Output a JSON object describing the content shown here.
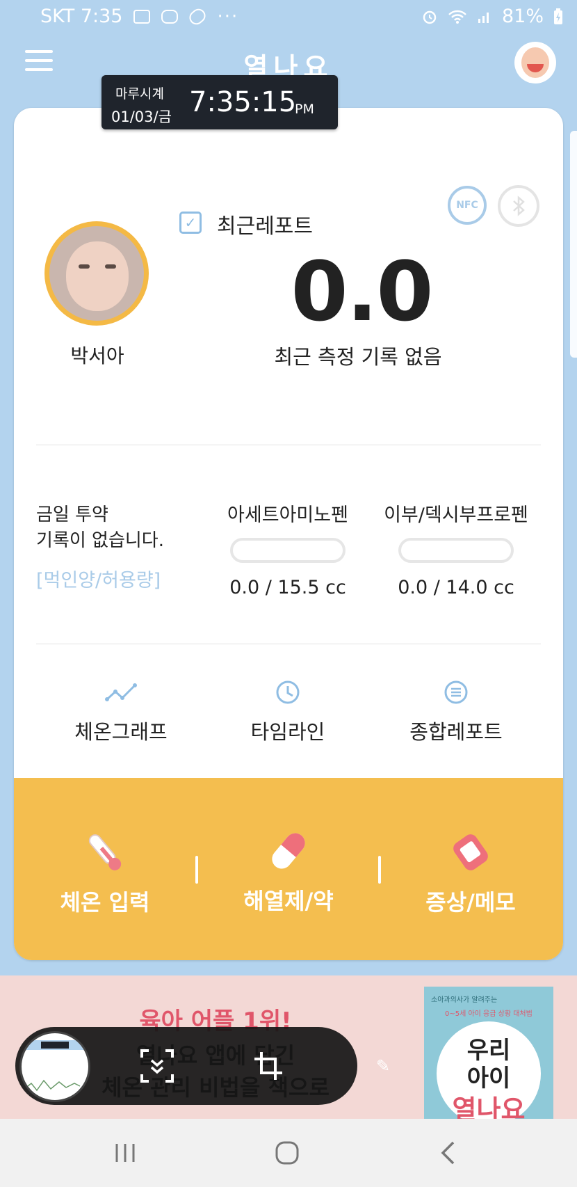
{
  "status_bar": {
    "carrier_time": "SKT 7:35",
    "dots": "···",
    "battery": "81%",
    "icons": [
      "image-icon",
      "blog-icon",
      "link-icon",
      "alarm-icon",
      "wifi-icon",
      "signal-icon",
      "battery-charging-icon"
    ]
  },
  "header": {
    "title": "열나요",
    "menu_icon": "hamburger-icon",
    "profile_icon": "baby-face-icon"
  },
  "clock_overlay": {
    "name": "마루시계",
    "date": "01/03/금",
    "time": "7:35:15",
    "ampm": "PM"
  },
  "card": {
    "nfc_label": "NFC",
    "bluetooth_icon": "bluetooth-icon",
    "child_name": "박서아",
    "report_label": "최근레포트",
    "temperature": "0.0",
    "status_text": "최근 측정 기록 없음",
    "medication": {
      "summary_line1": "금일 투약",
      "summary_line2": "기록이 없습니다.",
      "dose_link": "[먹인양/허용량]",
      "items": [
        {
          "name": "아세트아미노펜",
          "value": "0.0 / 15.5 cc",
          "fraction": 0.0
        },
        {
          "name": "이부/덱시부프로펜",
          "value": "0.0 / 14.0 cc",
          "fraction": 0.0
        }
      ]
    },
    "nav": [
      {
        "label": "체온그래프",
        "icon": "graph-icon"
      },
      {
        "label": "타임라인",
        "icon": "clock-icon"
      },
      {
        "label": "종합레포트",
        "icon": "list-icon"
      }
    ]
  },
  "actions": [
    {
      "label": "체온 입력",
      "icon": "thermometer-icon"
    },
    {
      "label": "해열제/약",
      "icon": "pill-icon"
    },
    {
      "label": "증상/메모",
      "icon": "bandage-icon"
    }
  ],
  "banner": {
    "headline": "육아 어플 1위!",
    "line2": "열나요 앱에 담긴",
    "line3": "체온 관리 비법을 책으로",
    "book_tag": "소아과의사가 알려주는",
    "book_subtitle": "0~5세 아이 응급 상황 대처법",
    "book_title1": "우리",
    "book_title2": "아이",
    "book_title3": "열나요"
  },
  "capture_toolbar": {
    "icons": [
      "screenshot-thumbnail",
      "scroll-capture-icon",
      "crop-icon",
      "pencil-icon"
    ]
  },
  "system_nav": {
    "icons": [
      "recents-icon",
      "home-icon",
      "back-icon"
    ]
  },
  "colors": {
    "background": "#b3d3ee",
    "accent_yellow": "#f4be4f",
    "accent_blue": "#a9cbe8",
    "banner_pink": "#f3d8d5",
    "headline_pink": "#e0566a"
  }
}
